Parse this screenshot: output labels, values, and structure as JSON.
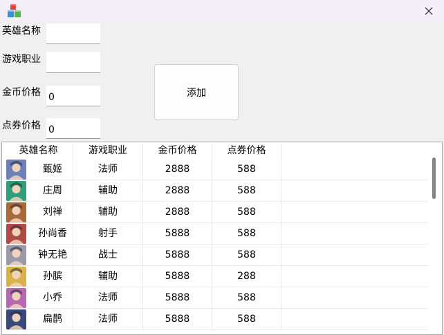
{
  "window": {
    "icon": "cubes-app-icon",
    "close": "close-icon"
  },
  "form": {
    "name_label": "英雄名称",
    "name_value": "",
    "role_label": "游戏职业",
    "role_value": "",
    "gold_label": "金币价格",
    "gold_value": "0",
    "voucher_label": "点券价格",
    "voucher_value": "0",
    "add_button": "添加"
  },
  "table": {
    "columns": [
      "英雄名称",
      "游戏职业",
      "金币价格",
      "点券价格"
    ],
    "rows": [
      {
        "name": "甄姬",
        "role": "法师",
        "gold": "2888",
        "voucher": "588",
        "avatar_color": "#6f7fb8"
      },
      {
        "name": "庄周",
        "role": "辅助",
        "gold": "2888",
        "voucher": "588",
        "avatar_color": "#2f9e7a"
      },
      {
        "name": "刘禅",
        "role": "辅助",
        "gold": "2888",
        "voucher": "588",
        "avatar_color": "#a86a3a"
      },
      {
        "name": "孙尚香",
        "role": "射手",
        "gold": "5888",
        "voucher": "588",
        "avatar_color": "#b24a4a"
      },
      {
        "name": "钟无艳",
        "role": "战士",
        "gold": "5888",
        "voucher": "588",
        "avatar_color": "#9a9aa8"
      },
      {
        "name": "孙膑",
        "role": "辅助",
        "gold": "5888",
        "voucher": "288",
        "avatar_color": "#d8b24a"
      },
      {
        "name": "小乔",
        "role": "法师",
        "gold": "5888",
        "voucher": "588",
        "avatar_color": "#b46ab0"
      },
      {
        "name": "扁鹊",
        "role": "法师",
        "gold": "5888",
        "voucher": "588",
        "avatar_color": "#3a4a7a"
      }
    ]
  }
}
